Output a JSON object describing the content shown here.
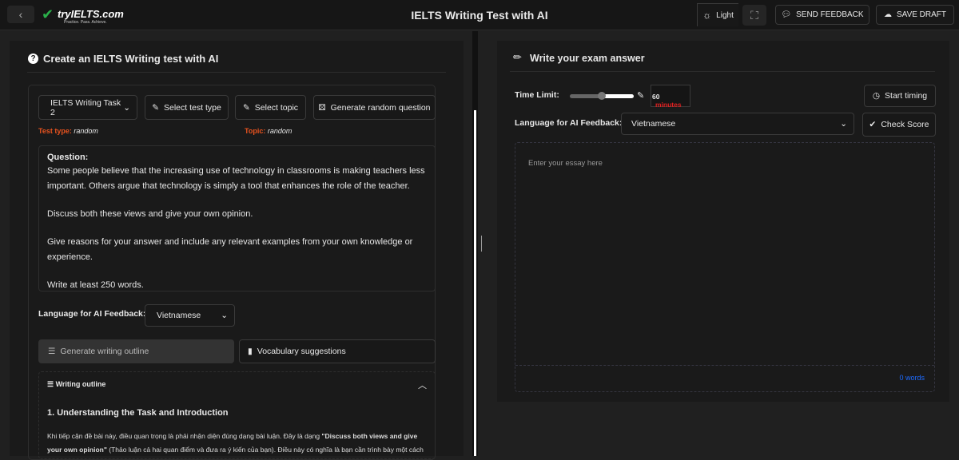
{
  "header": {
    "title": "IELTS Writing Test with AI",
    "logo_text": "tryIELTS.com",
    "logo_tagline": "Practice. Pass. Achieve.",
    "theme_label": "Light",
    "send_feedback": "SEND FEEDBACK",
    "save_draft": "SAVE DRAFT"
  },
  "left": {
    "title": "Create an IELTS Writing test with AI",
    "task_select": "IELTS Writing Task 2",
    "select_test_type": "Select test type",
    "select_topic": "Select topic",
    "generate_random": "Generate random question",
    "test_type_label": "Test type:",
    "test_type_value": "random",
    "topic_label": "Topic:",
    "topic_value": "random",
    "question_label": "Question:",
    "question_paragraphs": [
      "Some people believe that the increasing use of technology in classrooms is making teachers less important. Others argue that technology is simply a tool that enhances the role of the teacher.",
      "Discuss both these views and give your own opinion.",
      "Give reasons for your answer and include any relevant examples from your own knowledge or experience.",
      "Write at least 250 words."
    ],
    "language_label": "Language for AI Feedback:",
    "language_value": "Vietnamese",
    "generate_outline": "Generate writing outline",
    "vocab": "Vocabulary suggestions",
    "outline_title": "Writing outline",
    "outline_heading": "1. Understanding the Task and Introduction",
    "outline_text_1": "Khi tiếp cận đề bài này, điều quan trọng là phải nhận diện đúng dạng bài luận. Đây là dạng ",
    "outline_bold": "\"Discuss both views and give your own opinion\"",
    "outline_text_2": " (Thảo luận cả hai quan điểm và đưa ra ý kiến của bạn). Điều này có nghĩa là bạn cần trình bày một cách"
  },
  "right": {
    "title": "Write your exam answer",
    "time_limit_label": "Time Limit:",
    "time_value": "60",
    "time_unit": "minutes",
    "time_slider_fraction": 0.45,
    "start_timing": "Start timing",
    "language_label": "Language for AI Feedback:",
    "language_value": "Vietnamese",
    "check_score": "Check Score",
    "essay_placeholder": "Enter your essay here",
    "word_count": "0 words"
  },
  "colors": {
    "accent_orange": "#e8531f",
    "word_count_blue": "#1e6bff",
    "minutes_red": "#e02020"
  }
}
